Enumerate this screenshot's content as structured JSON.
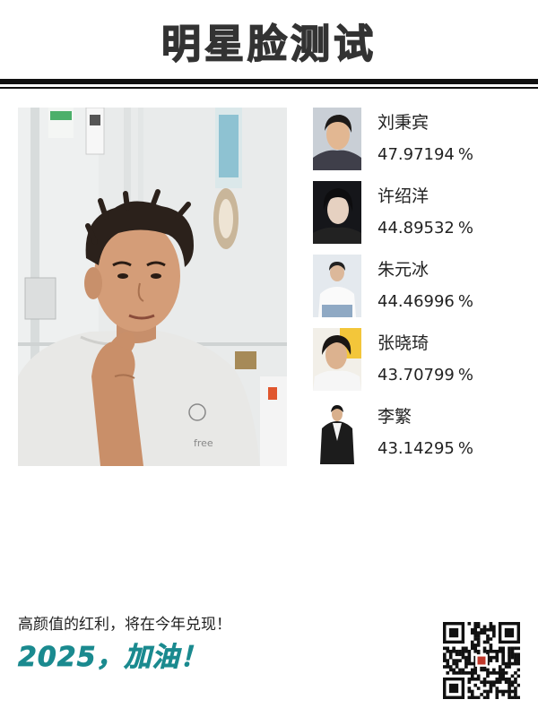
{
  "header": {
    "title": "明星脸测试"
  },
  "main_photo": {
    "icon": "user-portrait-photo"
  },
  "results": [
    {
      "name": "刘秉宾",
      "score": "47.97194",
      "unit": "%"
    },
    {
      "name": "许绍洋",
      "score": "44.89532",
      "unit": "%"
    },
    {
      "name": "朱元冰",
      "score": "44.46996",
      "unit": "%"
    },
    {
      "name": "张晓琦",
      "score": "43.70799",
      "unit": "%"
    },
    {
      "name": "李繁",
      "score": "43.14295",
      "unit": "%"
    }
  ],
  "footer": {
    "slogan": "高颜值的红利，将在今年兑现！",
    "cheer": "2025，加油！",
    "qr_icon": "qr-code-icon"
  },
  "colors": {
    "accent": "#1a8a8f",
    "title": "#333333",
    "rule": "#111111"
  }
}
